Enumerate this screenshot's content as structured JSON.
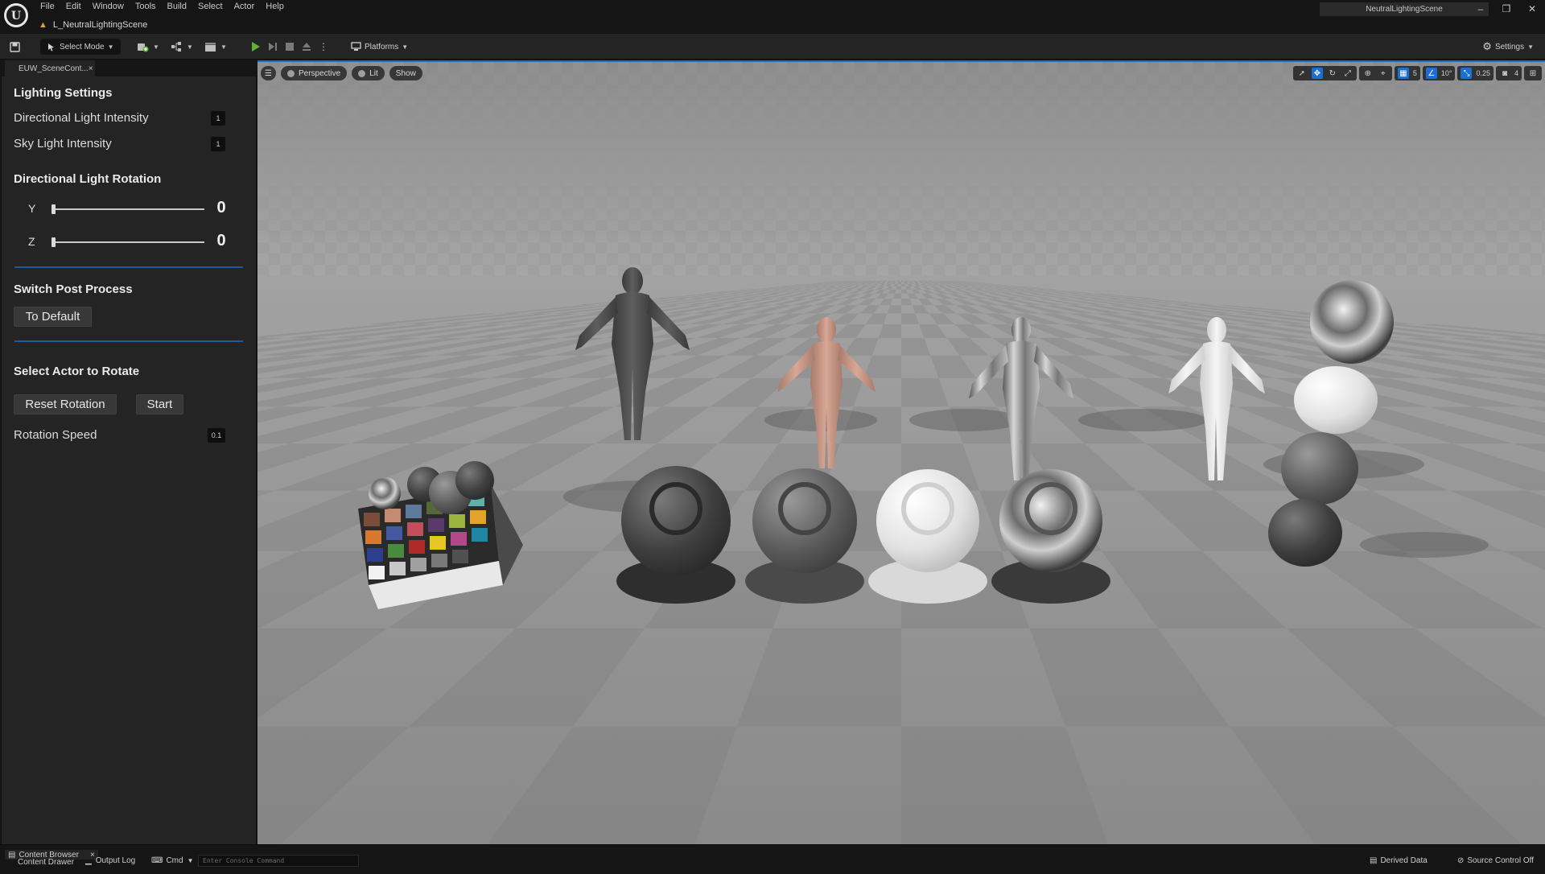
{
  "menu": [
    "File",
    "Edit",
    "Window",
    "Tools",
    "Build",
    "Select",
    "Actor",
    "Help"
  ],
  "level_tab": "L_NeutralLightingScene",
  "window_title": "NeutralLightingScene",
  "window_controls": {
    "minimize": "–",
    "restore": "❐",
    "close": "✕"
  },
  "toolbar": {
    "select_mode": "Select Mode",
    "platforms": "Platforms",
    "settings": "Settings"
  },
  "panel_tab": {
    "label": "EUW_SceneCont...",
    "close": "×"
  },
  "panel": {
    "lighting_title": "Lighting Settings",
    "dir_light_label": "Directional Light Intensity",
    "dir_light_value": "1",
    "sky_light_label": "Sky Light Intensity",
    "sky_light_value": "1",
    "rotation_title": "Directional Light Rotation",
    "y_label": "Y",
    "y_value": "0",
    "z_label": "Z",
    "z_value": "0",
    "post_title": "Switch Post Process",
    "to_default": "To Default",
    "actor_title": "Select Actor to Rotate",
    "reset_rotation": "Reset Rotation",
    "start": "Start",
    "speed_label": "Rotation Speed",
    "speed_value": "0.1"
  },
  "viewport": {
    "perspective": "Perspective",
    "lit": "Lit",
    "show": "Show",
    "grid_snap": "5",
    "rotation_snap": "10°",
    "scale_snap": "0.25",
    "camera_speed": "4"
  },
  "statusbar": {
    "content_drawer": "Content Drawer",
    "content_browser": "Content Browser",
    "output_log": "Output Log",
    "cmd": "Cmd",
    "console_placeholder": "Enter Console Command",
    "derived_data": "Derived Data",
    "source_control": "Source Control Off"
  },
  "colors": {
    "accent": "#1e6bc4",
    "panel_bg": "#242424",
    "play_green": "#5fb336",
    "level_icon": "#d9a33b"
  }
}
